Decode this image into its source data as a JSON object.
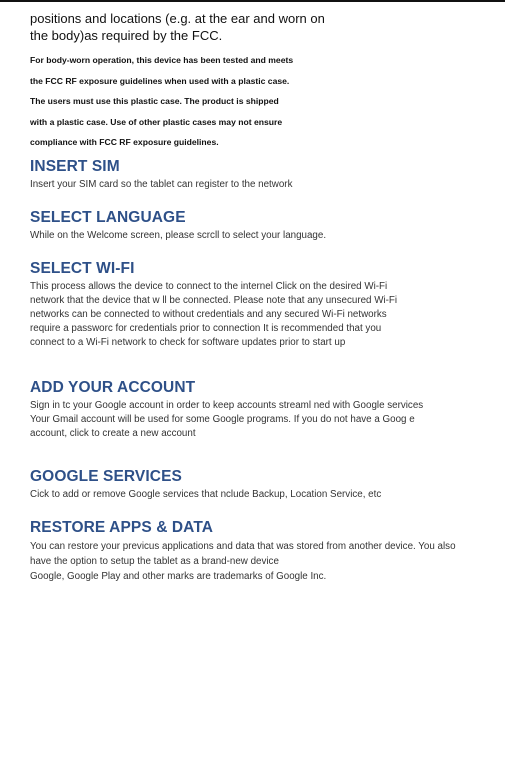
{
  "intro": {
    "line1": "positions and locations (e.g. at the ear and worn on",
    "line2": "the body)as required by the FCC."
  },
  "fcc": {
    "lines": [
      "For body-worn operation, this device has been tested and meets",
      "the FCC RF exposure guidelines when used with a plastic case.",
      "The users must use this plastic case. The product is shipped",
      "with a plastic case. Use of other plastic cases may not ensure",
      "compliance with FCC RF exposure guidelines."
    ]
  },
  "sections": {
    "insert_sim": {
      "heading": "INSERT SIM",
      "lines": [
        "Insert your SIM card so the tablet can register to the network"
      ]
    },
    "select_language": {
      "heading": "SELECT LANGUAGE",
      "lines": [
        "While on the Welcome screen, please scrcll to select your language."
      ]
    },
    "select_wifi": {
      "heading": "SELECT WI-FI",
      "lines": [
        "This process allows the device to connect to the internel  Click on the desired Wi-Fi",
        "network that the device that w ll be connected. Please note that any unsecured Wi-Fi",
        "networks can be connected to without credentials and any secured Wi-Fi networks",
        "require a passworc for credentials prior to connection  It is recommended that you",
        "connect to a Wi-Fi network to check for software updates prior to start up"
      ]
    },
    "add_account": {
      "heading": "ADD YOUR ACCOUNT",
      "lines": [
        "Sign in tc your Google account in order to keep accounts streaml ned with Google services",
        "Your Gmail account will be used for some Google programs. If you do not have a Goog e",
        "account, click to create a new account"
      ]
    },
    "google_services": {
      "heading": "GOOGLE SERVICES",
      "lines": [
        "Cick to add or remove Google services that  nclude Backup, Location Service, etc"
      ]
    },
    "restore_apps": {
      "heading": "RESTORE APPS & DATA",
      "lines": [
        "You can restore your previcus applications and data that was stored from another device. You also",
        "have the option to setup the tablet as a brand-new device",
        "Google, Google Play and other marks are trademarks of Google Inc."
      ]
    }
  }
}
